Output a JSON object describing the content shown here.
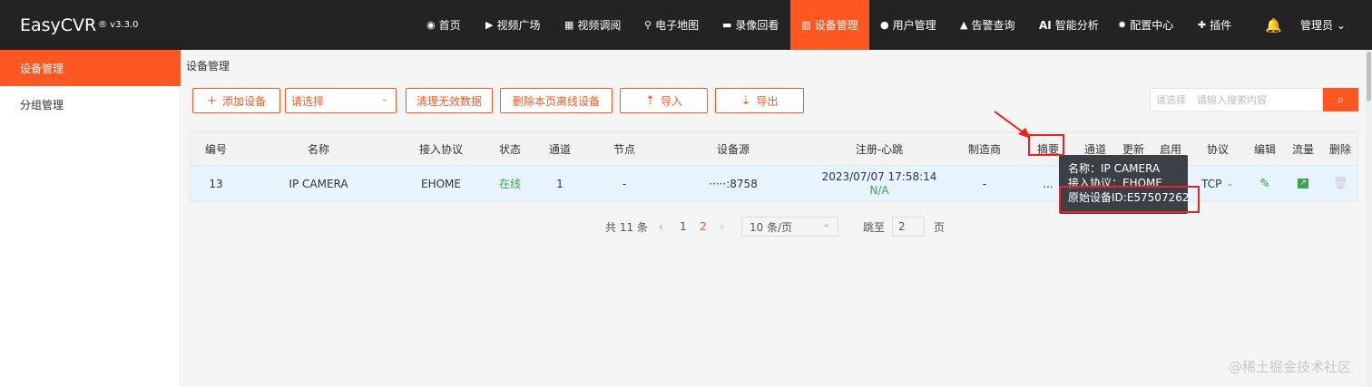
{
  "app": {
    "logo": "EasyCVR",
    "version": "® v3.3.0"
  },
  "nav": [
    {
      "label": "首页",
      "icon": "dashboard-icon"
    },
    {
      "label": "视频广场",
      "icon": "play-icon"
    },
    {
      "label": "视频调阅",
      "icon": "grid-icon"
    },
    {
      "label": "电子地图",
      "icon": "map-pin-icon"
    },
    {
      "label": "录像回看",
      "icon": "video-camera-icon"
    },
    {
      "label": "设备管理",
      "icon": "device-icon",
      "active": true
    },
    {
      "label": "用户管理",
      "icon": "user-icon"
    },
    {
      "label": "告警查询",
      "icon": "alarm-icon"
    },
    {
      "label": "智能分析",
      "icon": "ai-icon",
      "prefix": "AI"
    },
    {
      "label": "配置中心",
      "icon": "gear-icon"
    },
    {
      "label": "插件",
      "icon": "puzzle-icon"
    }
  ],
  "user": {
    "label": "管理员 ⌄"
  },
  "sidebar": [
    {
      "label": "设备管理",
      "active": true
    },
    {
      "label": "分组管理"
    }
  ],
  "breadcrumb": "设备管理",
  "toolbar": {
    "add": "添加设备",
    "select_placeholder": "请选择",
    "clear": "清理无效数据",
    "delete_offline": "删除本页离线设备",
    "import": "导入",
    "export": "导出",
    "search_select": "请选择",
    "search_placeholder": "请输入搜索内容"
  },
  "table": {
    "headers": [
      "编号",
      "名称",
      "接入协议",
      "状态",
      "通道",
      "节点",
      "设备源",
      "注册-心跳",
      "制造商",
      "摘要",
      "通道",
      "更新",
      "启用",
      "协议",
      "编辑",
      "流量",
      "删除"
    ],
    "row": {
      "id": "13",
      "name": "IP CAMERA",
      "protocol": "EHOME",
      "status": "在线",
      "channel": "1",
      "node": "-",
      "source": "·····:8758",
      "register": "2023/07/07 17:58:14",
      "heartbeat": "N/A",
      "maker": "-",
      "summary": "...",
      "proto": "TCP"
    }
  },
  "tooltip": {
    "line1": "名称：IP CAMERA",
    "line2": "接入协议：EHOME",
    "line3": "原始设备ID:E57507262"
  },
  "pager": {
    "total": "共 11 条",
    "page1": "1",
    "page2": "2",
    "size": "10 条/页",
    "jump_label": "跳至",
    "jump_value": "2",
    "page_unit": "页"
  },
  "watermark": "@稀土掘金技术社区",
  "colors": {
    "accent": "#ff5722",
    "topbar": "#232323",
    "online": "#3aa64a"
  }
}
